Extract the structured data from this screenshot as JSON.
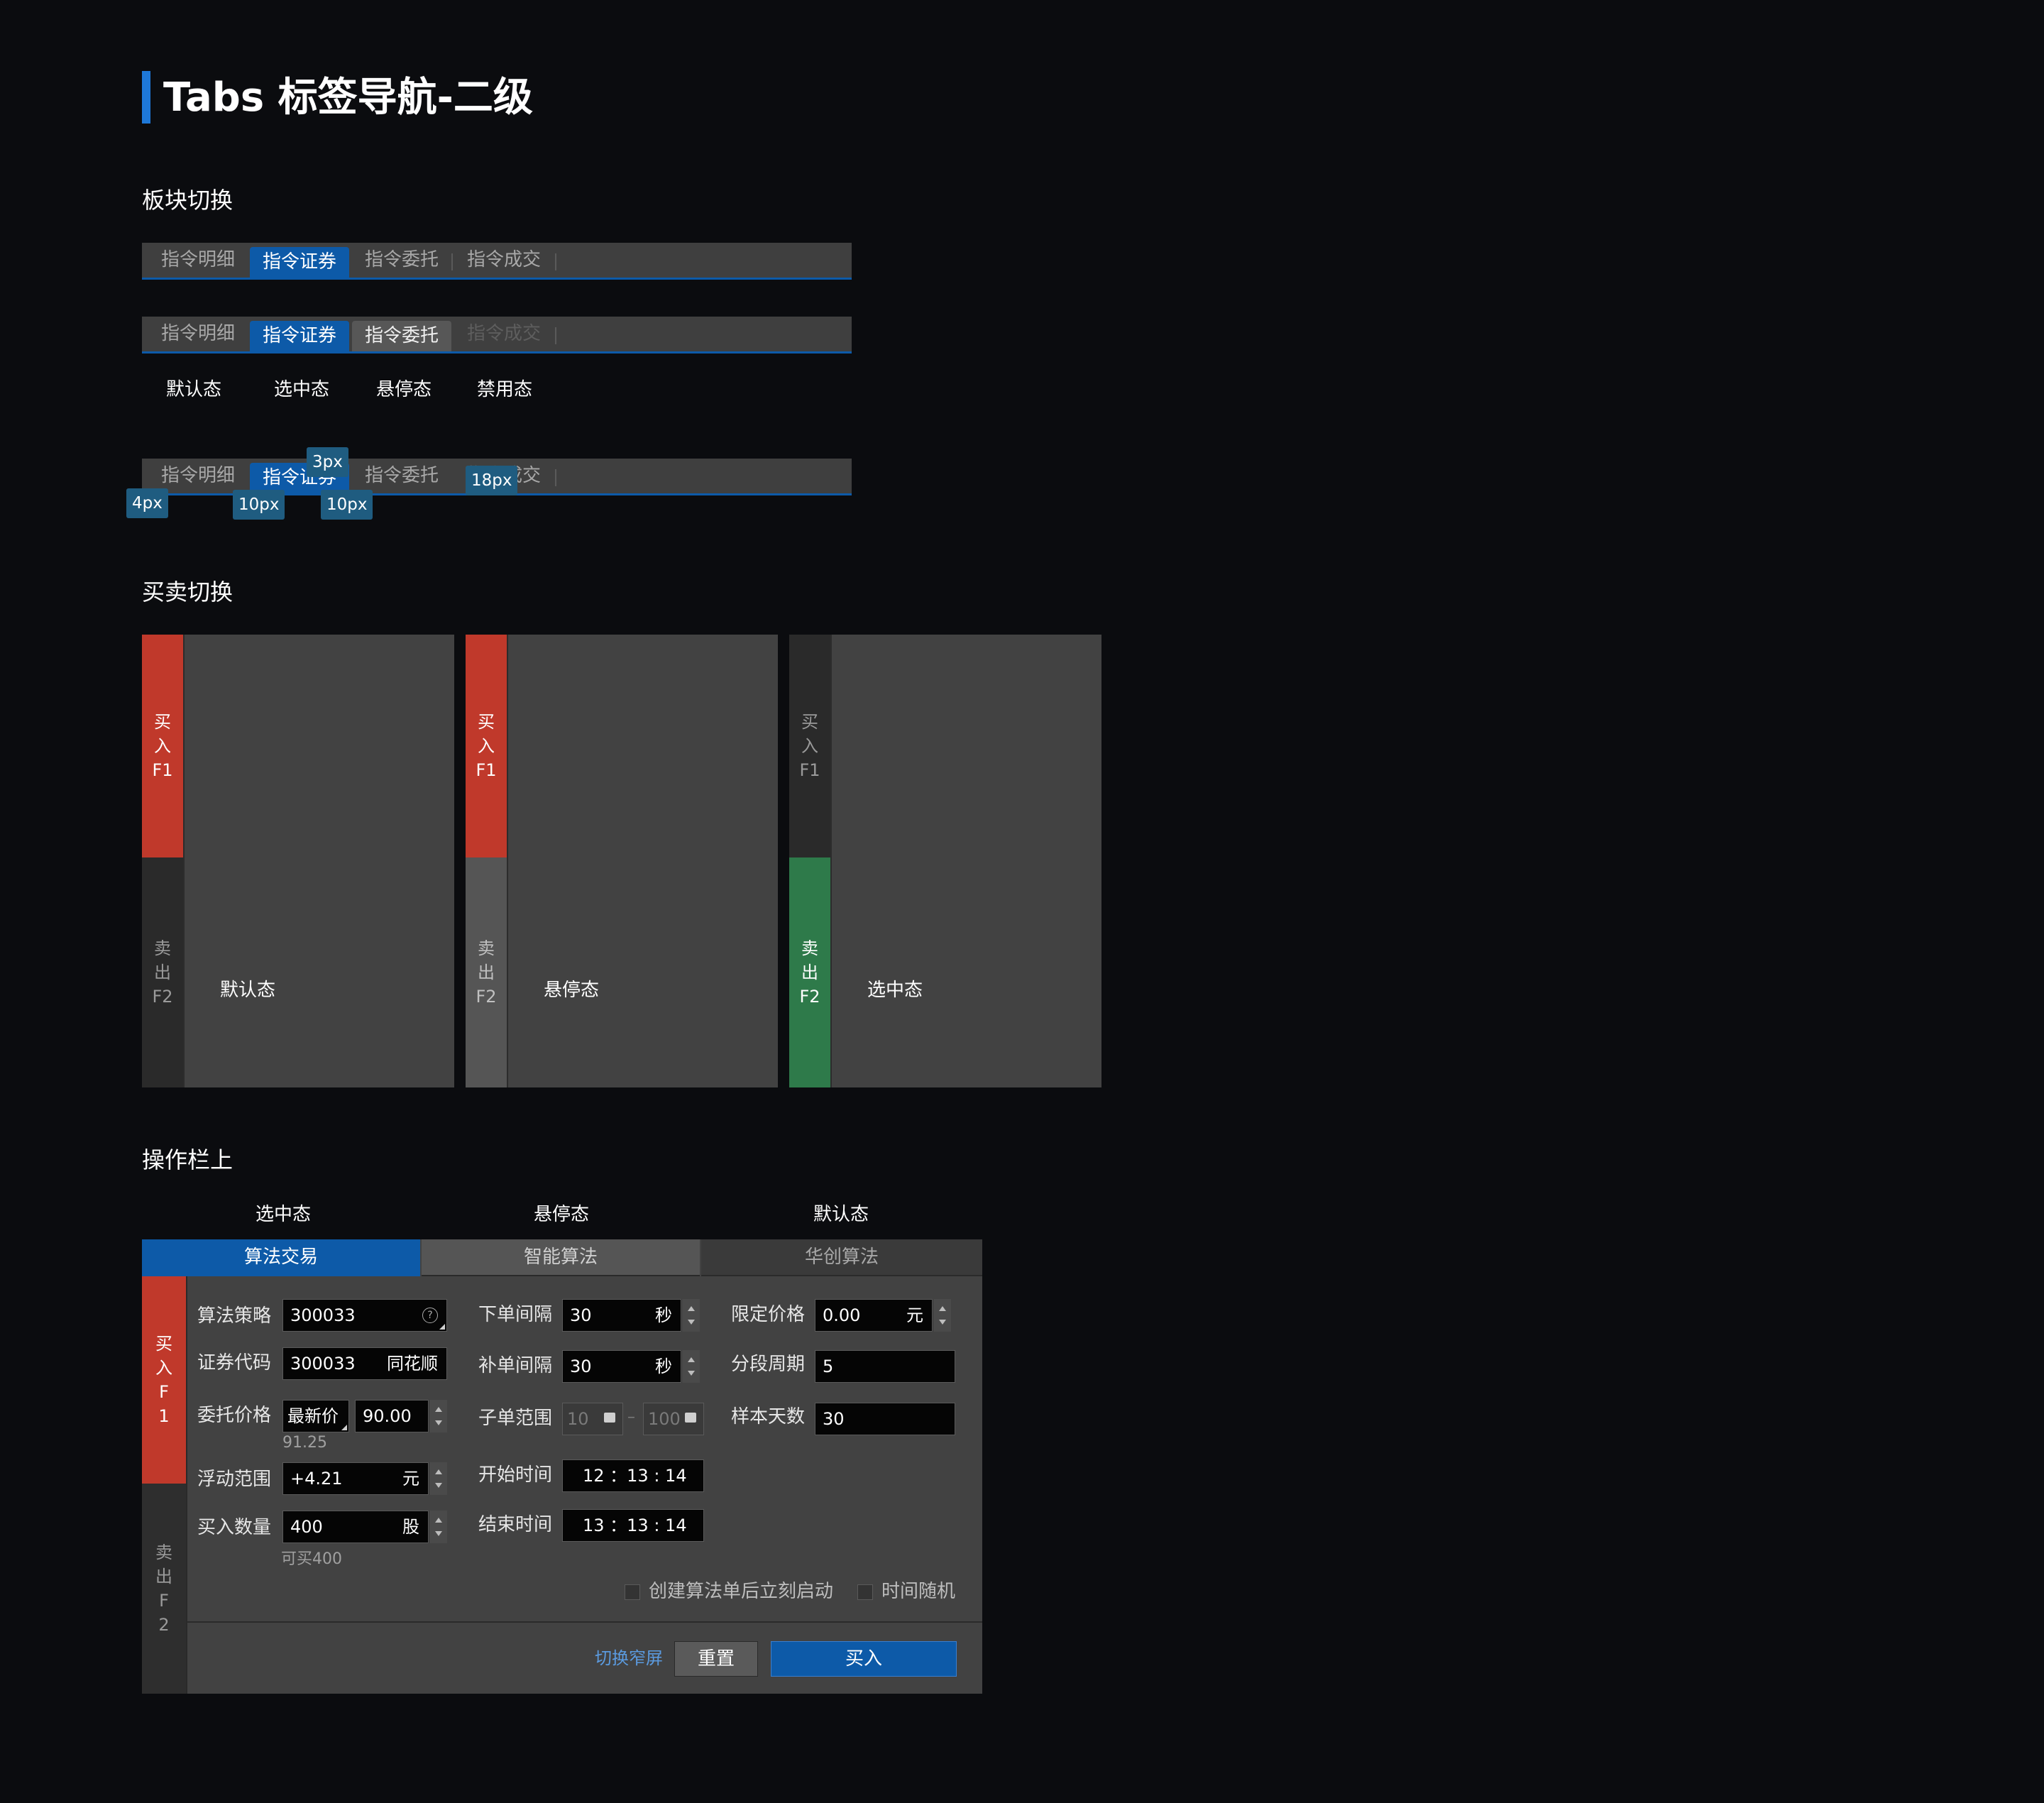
{
  "page": {
    "title": "Tabs 标签导航-二级",
    "section_block": "板块切换",
    "section_buysell": "买卖切换",
    "section_op": "操作栏上"
  },
  "block_tabs": {
    "row1": [
      "指令明细",
      "指令证券",
      "指令委托",
      "指令成交"
    ],
    "row2": [
      "指令明细",
      "指令证券",
      "指令委托",
      "指令成交"
    ],
    "row3": [
      "指令明细",
      "指令证券",
      "指令委托",
      "指令成交"
    ],
    "states": [
      "默认态",
      "选中态",
      "悬停态",
      "禁用态"
    ],
    "spec": [
      "4px",
      "10px",
      "3px",
      "10px",
      "18px"
    ]
  },
  "buysell": {
    "buy": [
      "买",
      "入",
      "F1"
    ],
    "sell": [
      "卖",
      "出",
      "F2"
    ],
    "labels": [
      "默认态",
      "悬停态",
      "选中态"
    ]
  },
  "op": {
    "state_labels": [
      "选中态",
      "悬停态",
      "默认态"
    ],
    "tabs": [
      "算法交易",
      "智能算法",
      "华创算法"
    ],
    "buy": [
      "买",
      "入",
      "F",
      "1"
    ],
    "sell": [
      "卖",
      "出",
      "F",
      "2"
    ],
    "col1": {
      "strategy_label": "算法策略",
      "strategy_value": "300033",
      "code_label": "证券代码",
      "code_value": "300033",
      "code_name": "同花顺",
      "price_label": "委托价格",
      "price_type": "最新价",
      "price_value": "90.00",
      "price_hint": "91.25",
      "float_label": "浮动范围",
      "float_value": "+4.21",
      "float_unit": "元",
      "qty_label": "买入数量",
      "qty_value": "400",
      "qty_unit": "股",
      "qty_hint": "可买400"
    },
    "col2": {
      "interval_label": "下单间隔",
      "interval_value": "30",
      "interval_unit": "秒",
      "re_label": "补单间隔",
      "re_value": "30",
      "re_unit": "秒",
      "range_label": "子单范围",
      "range_min": "10",
      "range_sep": "–",
      "range_max": "100",
      "start_label": "开始时间",
      "start_value": "12 ：13 : 14",
      "end_label": "结束时间",
      "end_value": "13 ：13 : 14"
    },
    "col3": {
      "limit_label": "限定价格",
      "limit_value": "0.00",
      "limit_unit": "元",
      "period_label": "分段周期",
      "period_value": "5",
      "days_label": "样本天数",
      "days_value": "30"
    },
    "check_start": "创建算法单后立刻启动",
    "check_random": "时间随机",
    "link_narrow": "切换窄屏",
    "btn_reset": "重置",
    "btn_buy": "买入"
  },
  "colors": {
    "accent": "#0d5aa8",
    "buy": "#c0392b",
    "sell": "#2e7a4a",
    "bg": "#0b0c0f",
    "panel": "#424242"
  }
}
